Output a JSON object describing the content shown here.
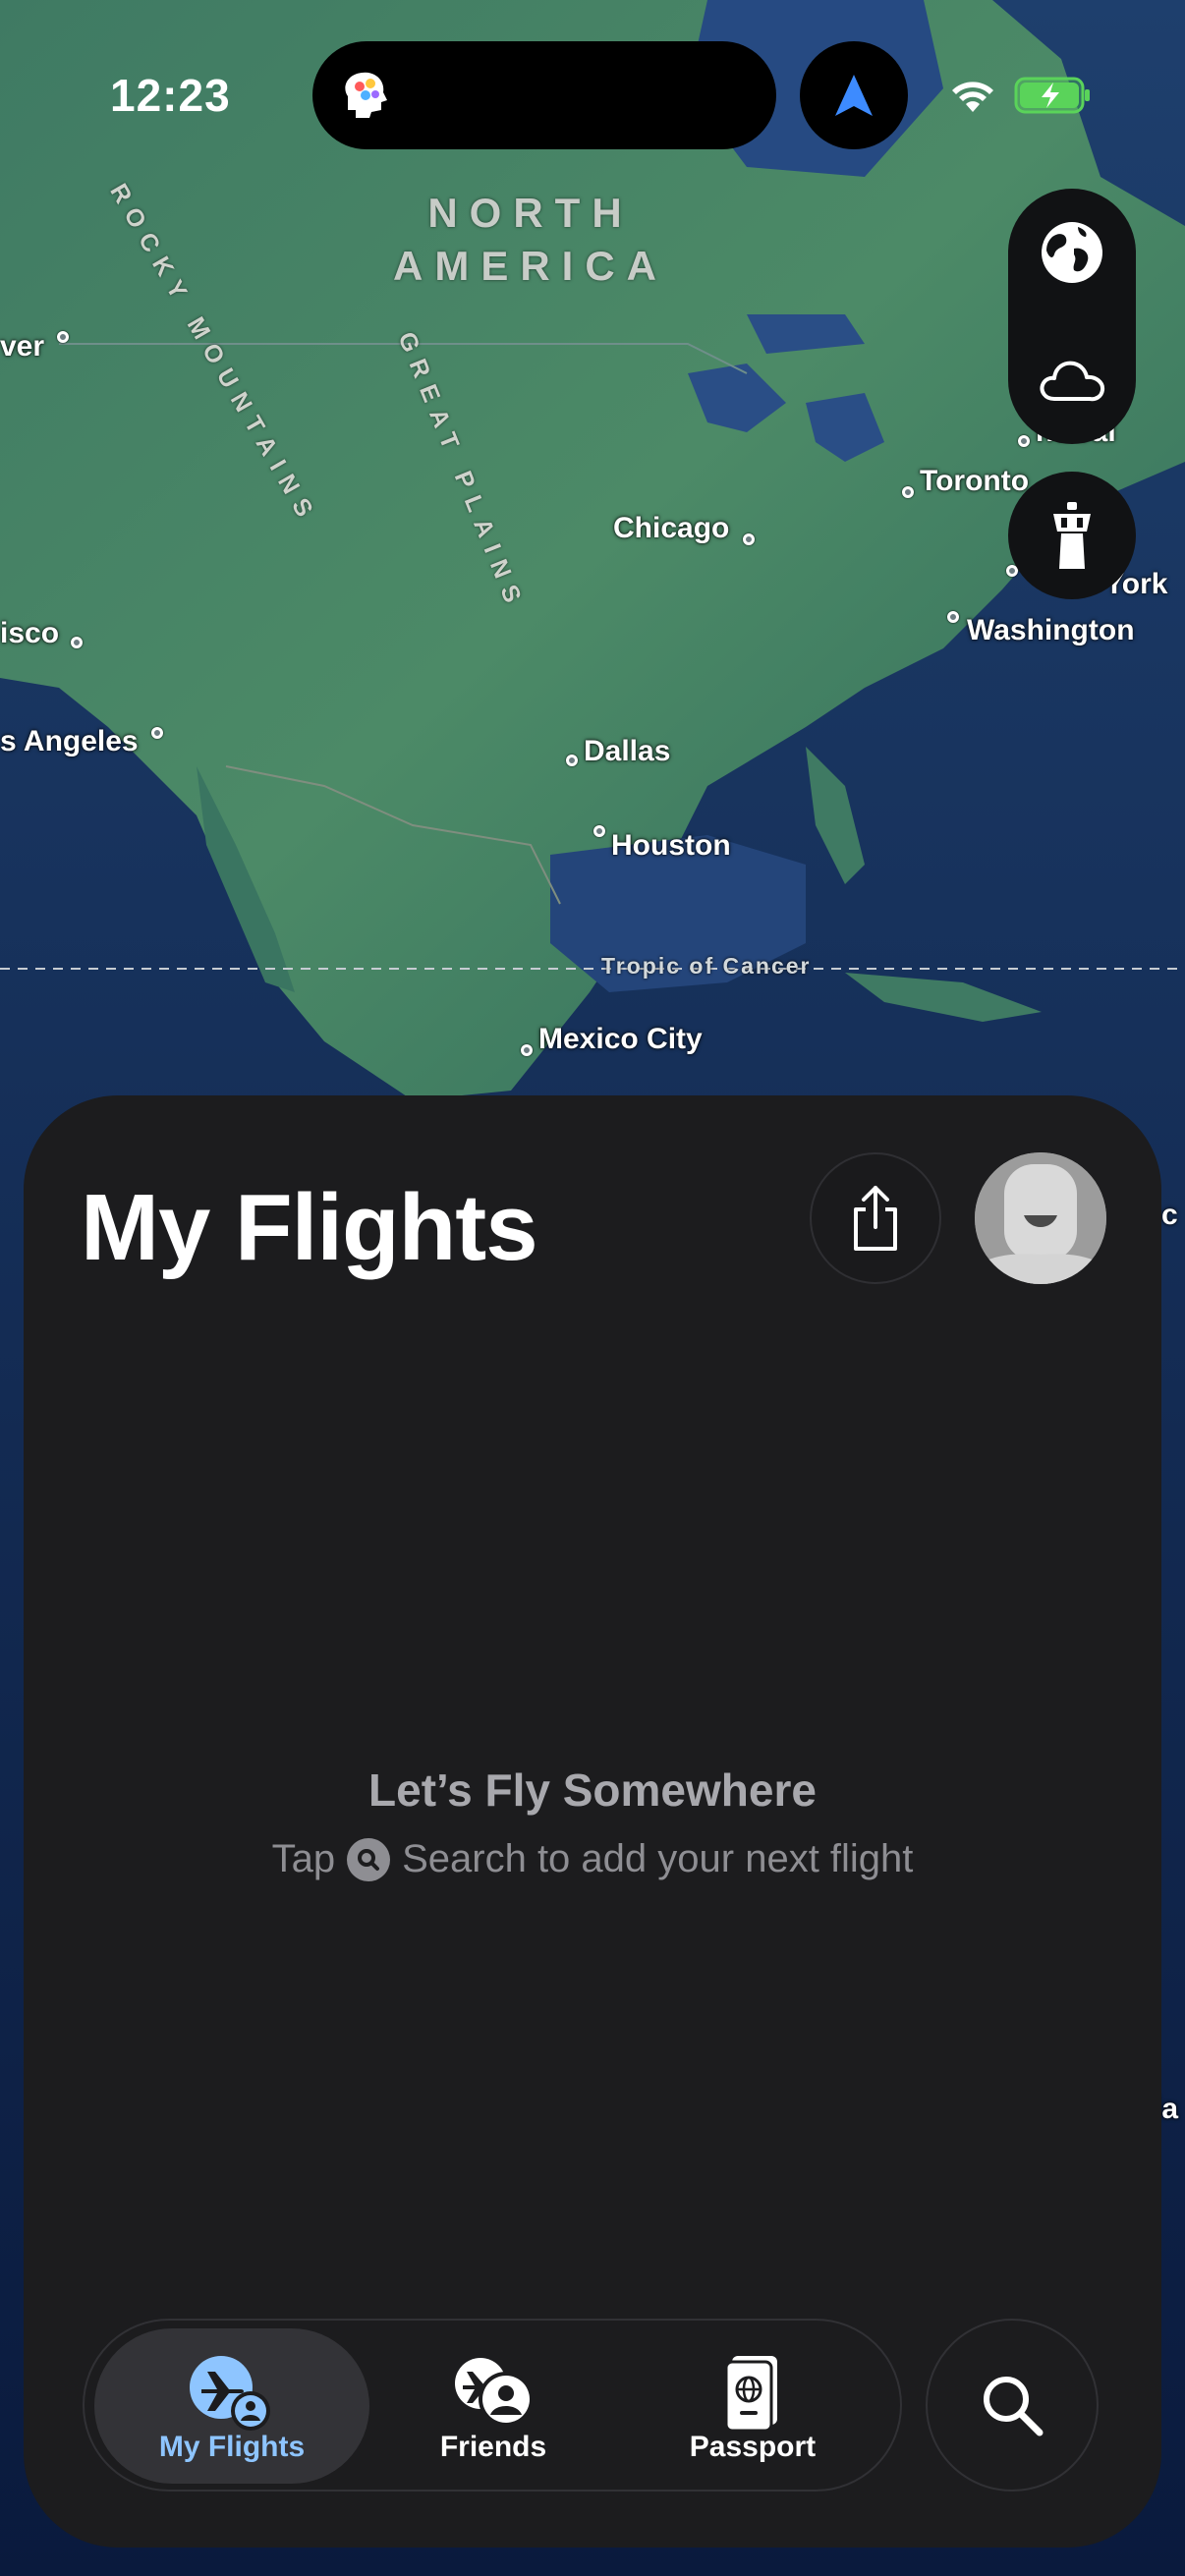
{
  "status_bar": {
    "time": "12:23"
  },
  "map": {
    "region_label_line1": "NORTH",
    "region_label_line2": "AMERICA",
    "mountain_labels": [
      "ROCKY MOUNTAINS",
      "GREAT PLAINS"
    ],
    "tropic_label": "Tropic of Cancer",
    "cities": {
      "vancouver": "ver",
      "san_francisco": "isco",
      "los_angeles": "s Angeles",
      "chicago": "Chicago",
      "dallas": "Dallas",
      "houston": "Houston",
      "mexico_city": "Mexico City",
      "toronto": "Toronto",
      "montreal": "ntréal",
      "new_york": "York",
      "washington": "Washington",
      "edge_c": "c",
      "edge_ia": "ia"
    },
    "controls": [
      "globe-icon",
      "cloud-icon",
      "tower-icon"
    ]
  },
  "sheet": {
    "title": "My Flights",
    "empty_title": "Let’s Fly Somewhere",
    "empty_prefix": "Tap",
    "empty_suffix": "Search to add your next flight"
  },
  "tabs": [
    {
      "label": "My Flights",
      "active": true
    },
    {
      "label": "Friends",
      "active": false
    },
    {
      "label": "Passport",
      "active": false
    }
  ],
  "colors": {
    "sheet_bg": "#1c1c1e",
    "active_tab_text": "#8ec5ff",
    "accent_nav": "#3d8bff",
    "battery": "#5ad35a"
  }
}
